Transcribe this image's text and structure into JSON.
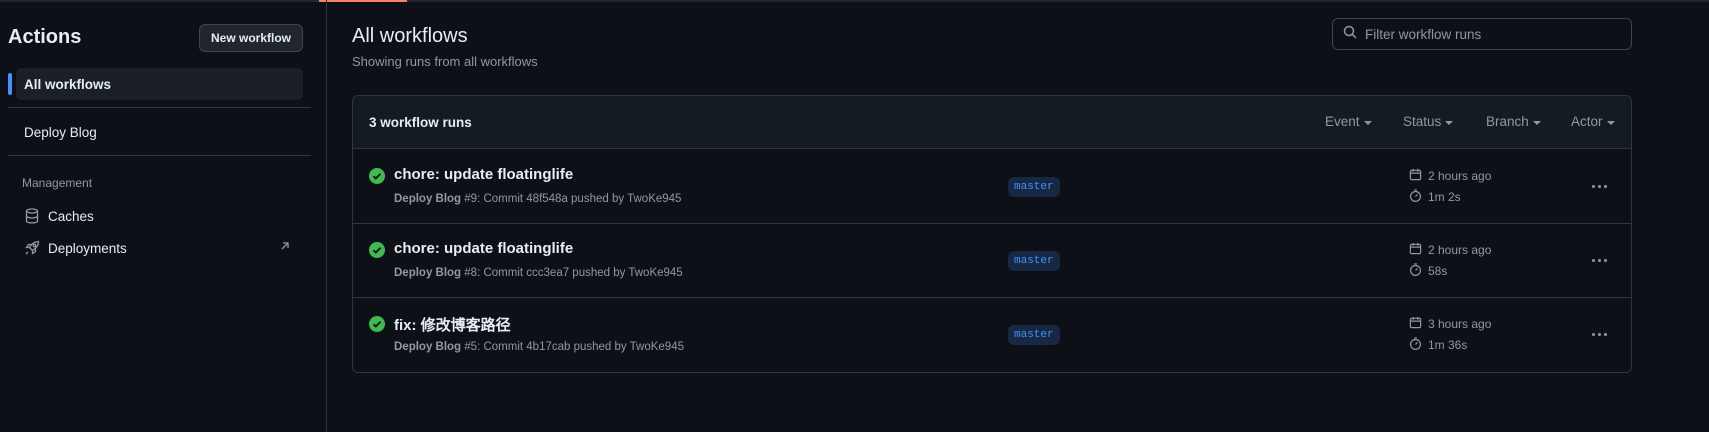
{
  "sidebar": {
    "title": "Actions",
    "new_workflow_label": "New workflow",
    "active_item": "All workflows",
    "workflows": [
      "Deploy Blog"
    ],
    "management_label": "Management",
    "management_items": [
      {
        "label": "Caches",
        "icon": "database-icon"
      },
      {
        "label": "Deployments",
        "icon": "rocket-icon"
      }
    ]
  },
  "main": {
    "title": "All workflows",
    "subtitle": "Showing runs from all workflows",
    "filter_placeholder": "Filter workflow runs",
    "runs_count": "3 workflow runs",
    "header_filters": [
      "Event",
      "Status",
      "Branch",
      "Actor"
    ],
    "runs": [
      {
        "title": "chore: update floatinglife",
        "workflow": "Deploy Blog",
        "meta": " #9: Commit 48f548a pushed by TwoKe945",
        "branch": "master",
        "when": "2 hours ago",
        "duration": "1m 2s",
        "status": "success"
      },
      {
        "title": "chore: update floatinglife",
        "workflow": "Deploy Blog",
        "meta": " #8: Commit ccc3ea7 pushed by TwoKe945",
        "branch": "master",
        "when": "2 hours ago",
        "duration": "58s",
        "status": "success"
      },
      {
        "title": "fix: 修改博客路径",
        "workflow": "Deploy Blog",
        "meta": " #5: Commit 4b17cab pushed by TwoKe945",
        "branch": "master",
        "when": "3 hours ago",
        "duration": "1m 36s",
        "status": "success"
      }
    ]
  },
  "colors": {
    "background": "#0d1117",
    "accent_blue": "#4493f8",
    "success_green": "#3fb950",
    "tab_underline": "#f78166"
  }
}
